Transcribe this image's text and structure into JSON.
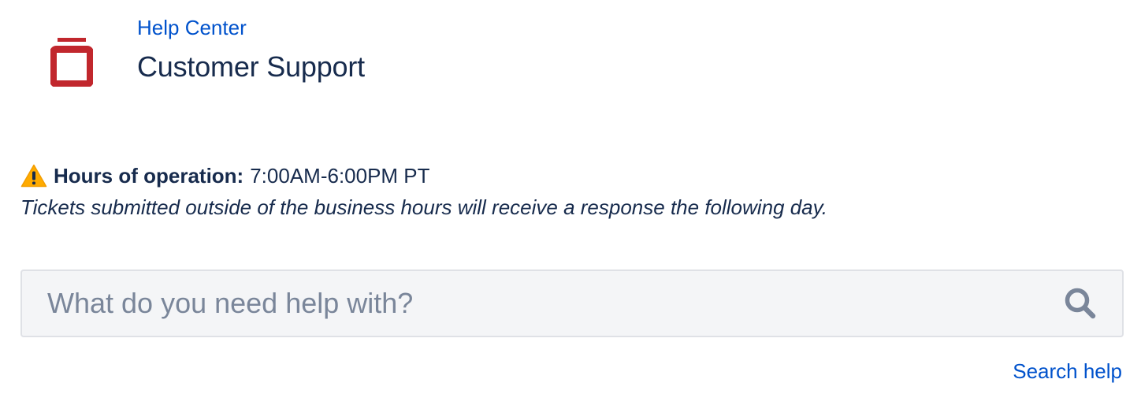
{
  "header": {
    "breadcrumb": "Help Center",
    "title": "Customer Support",
    "logo_icon": "portal-logo-icon",
    "logo_color": "#c1272d"
  },
  "notice": {
    "icon": "warning-icon",
    "hours_label": "Hours of operation:",
    "hours_value": "7:00AM-6:00PM PT",
    "message": "Tickets submitted outside of the business hours will receive a response the following day."
  },
  "search": {
    "placeholder": "What do you need help with?",
    "value": "",
    "icon": "search-icon"
  },
  "footer": {
    "search_help_label": "Search help"
  },
  "colors": {
    "link": "#0052cc",
    "text": "#172b4d",
    "input_bg": "#f4f5f7",
    "input_border": "#dfe1e6",
    "placeholder": "#7a869a",
    "warning": "#ffab00"
  }
}
